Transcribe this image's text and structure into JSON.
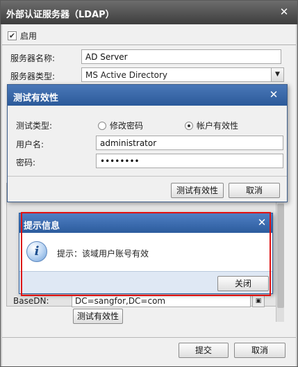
{
  "main_dialog": {
    "title": "外部认证服务器（LDAP）",
    "close_glyph": "✕",
    "enable_label": "启用",
    "enable_checked": true,
    "server_name_label": "服务器名称:",
    "server_name_value": "AD Server",
    "server_type_label": "服务器类型:",
    "server_type_value": "MS Active Directory",
    "base_dn_label": "BaseDN:",
    "base_dn_value": "DC=sangfor,DC=com",
    "test_validity_button": "测试有效性",
    "submit_button": "提交",
    "cancel_button": "取消"
  },
  "test_dialog": {
    "title": "测试有效性",
    "close_glyph": "✕",
    "test_type_label": "测试类型:",
    "options": [
      {
        "label": "修改密码",
        "selected": false
      },
      {
        "label": "帐户有效性",
        "selected": true
      }
    ],
    "username_label": "用户名:",
    "username_value": "administrator",
    "password_label": "密码:",
    "password_value": "••••••••",
    "test_button": "测试有效性",
    "cancel_button": "取消"
  },
  "info_dialog": {
    "title": "提示信息",
    "close_glyph": "✕",
    "icon": "info-icon",
    "message": "提示：该域用户账号有效",
    "close_button": "关闭"
  },
  "colors": {
    "highlight": "#e01010",
    "title_blue": "#2c5c9d",
    "title_gray": "#4a4a4a"
  }
}
